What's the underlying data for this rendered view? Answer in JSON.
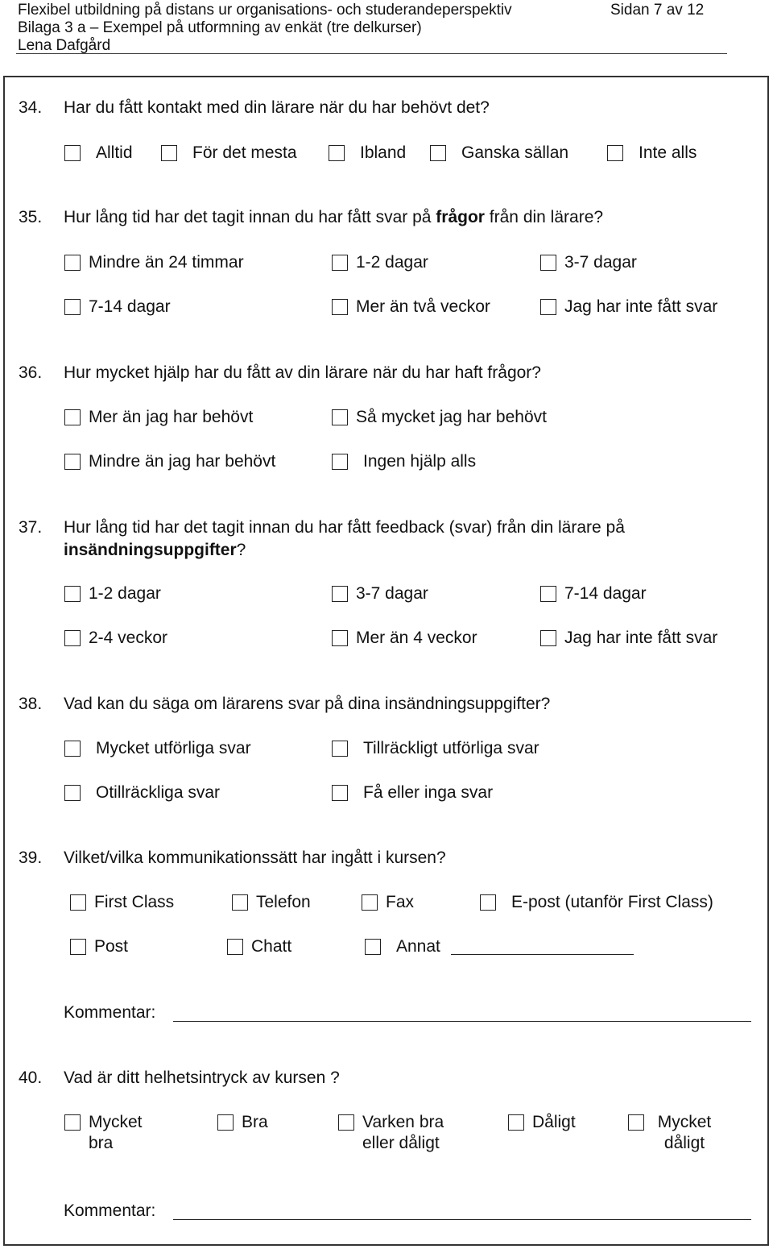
{
  "header": {
    "title": "Flexibel utbildning på distans ur organisations- och studerandeperspektiv",
    "page": "Sidan 7 av 12",
    "subtitle": "Bilaga 3 a – Exempel på utformning av enkät (tre delkurser)",
    "author": "Lena Dafgård"
  },
  "questions": [
    {
      "number": "34.",
      "text": "Har du fått kontakt med din lärare när du har behövt det?",
      "options": [
        "Alltid",
        "För det mesta",
        "Ibland",
        "Ganska sällan",
        "Inte alls"
      ]
    },
    {
      "number": "35.",
      "text_before": "Hur lång tid har det tagit innan du har fått svar på ",
      "text_bold": "frågor",
      "text_after": " från din lärare?",
      "options": [
        "Mindre än 24 timmar",
        "1-2 dagar",
        "3-7 dagar",
        "7-14 dagar",
        "Mer än två veckor",
        "Jag har inte fått svar"
      ]
    },
    {
      "number": "36.",
      "text": "Hur mycket hjälp har du fått av din lärare när du har haft frågor?",
      "options": [
        "Mer än jag har behövt",
        "Så mycket jag har behövt",
        "Mindre än jag har behövt",
        "Ingen hjälp alls"
      ]
    },
    {
      "number": "37.",
      "text_line1": "Hur lång tid har det tagit innan du har fått feedback (svar) från din lärare på",
      "text_bold": "insändningsuppgifter",
      "text_after": "?",
      "options": [
        "1-2 dagar",
        "3-7 dagar",
        "7-14 dagar",
        "2-4 veckor",
        "Mer än 4 veckor",
        "Jag har inte fått svar"
      ]
    },
    {
      "number": "38.",
      "text": "Vad kan du säga om lärarens svar på dina insändningsuppgifter?",
      "options": [
        "Mycket utförliga svar",
        "Tillräckligt utförliga svar",
        "Otillräckliga svar",
        "Få eller inga svar"
      ]
    },
    {
      "number": "39.",
      "text": "Vilket/vilka kommunikationssätt har ingått i kursen?",
      "options": [
        "First Class",
        "Telefon",
        "Fax",
        "E-post (utanför First Class)",
        "Post",
        "Chatt",
        "Annat"
      ],
      "comment_label": "Kommentar:"
    },
    {
      "number": "40.",
      "text": "Vad är ditt helhetsintryck av kursen ?",
      "options": [
        "Mycket bra",
        "Bra",
        "Varken bra eller dåligt",
        "Dåligt",
        "Mycket dåligt"
      ],
      "comment_label": "Kommentar:"
    }
  ]
}
